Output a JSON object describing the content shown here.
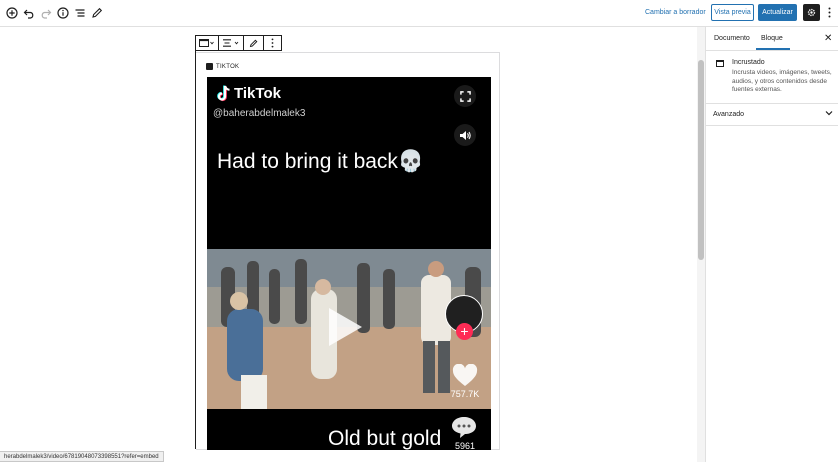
{
  "toolbar": {
    "icons": [
      "add-block-icon",
      "undo-icon",
      "redo-icon",
      "info-icon",
      "list-view-icon",
      "edit-pen-icon"
    ],
    "switch_to_draft": "Cambiar a borrador",
    "preview": "Vista previa",
    "update": "Actualizar",
    "settings_icon": "gear-icon",
    "more_icon": "vertical-ellipsis-icon"
  },
  "block_toolbar": {
    "icons": [
      "embed-block-icon",
      "align-icon",
      "edit-icon",
      "more-options-icon"
    ]
  },
  "embed": {
    "provider_label": "TIKTOK",
    "tiktok": {
      "logo_text": "TikTok",
      "handle": "@baherabdelmalek3",
      "caption": "Had to bring it back💀",
      "second_caption": "Old but gold",
      "like_count": "757.7K",
      "comment_count": "5961"
    }
  },
  "status_bar": {
    "url": "herabdelmalek3/video/67819048073398551?refer=embed"
  },
  "sidebar": {
    "tabs": [
      "Documento",
      "Bloque"
    ],
    "active_tab": "Bloque",
    "block_title": "Incrustado",
    "block_description": "Incrusta videos, imágenes, tweets, audios, y otros contenidos desde fuentes externas.",
    "advanced": "Avanzado"
  },
  "colors": {
    "accent": "#2271b1",
    "tiktok_red": "#fe2c55",
    "dark": "#1e1e1e"
  }
}
